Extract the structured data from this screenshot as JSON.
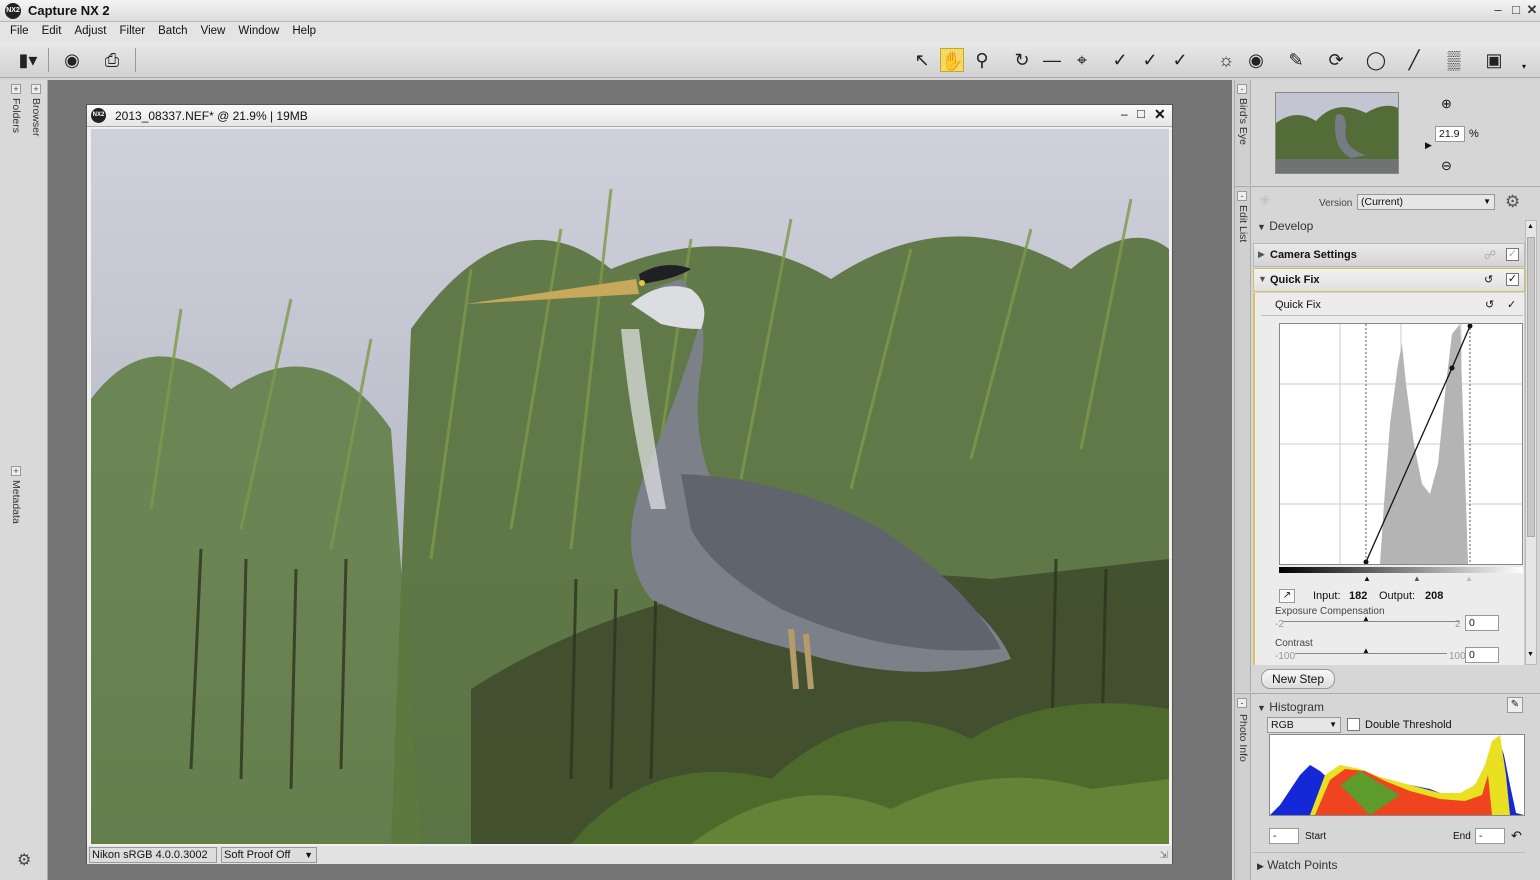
{
  "app": {
    "title": "Capture NX 2",
    "logo_text": "NX2"
  },
  "menu": [
    "File",
    "Edit",
    "Adjust",
    "Filter",
    "Batch",
    "View",
    "Window",
    "Help"
  ],
  "left_panels": {
    "folders": "Folders",
    "browser": "Browser",
    "metadata": "Metadata"
  },
  "image_window": {
    "title": "2013_08337.NEF* @ 21.9% | 19MB",
    "profile": "Nikon sRGB 4.0.0.3002",
    "soft_proof": "Soft Proof Off"
  },
  "birds_eye": {
    "label": "Bird's Eye",
    "zoom": "21.9",
    "unit": "%"
  },
  "edit_list": {
    "label": "Edit List",
    "version_label": "Version",
    "version_value": "(Current)",
    "develop": "Develop",
    "camera_settings": "Camera Settings",
    "quick_fix_header": "Quick Fix",
    "quick_fix_step": "Quick Fix",
    "input_label": "Input:",
    "input_value": "182",
    "output_label": "Output:",
    "output_value": "208",
    "exposure_label": "Exposure Compensation",
    "exposure_min": "-2",
    "exposure_max": "2",
    "exposure_value": "0",
    "contrast_label": "Contrast",
    "contrast_min": "-100",
    "contrast_max": "100",
    "contrast_value": "0",
    "new_step": "New Step"
  },
  "photo_info": {
    "label": "Photo Info",
    "histogram": "Histogram",
    "channel": "RGB",
    "double_threshold": "Double Threshold",
    "start_label": "Start",
    "start_value": "-",
    "end_label": "End",
    "end_value": "-",
    "watch_points": "Watch Points"
  },
  "colors": {
    "accent": "#f3d86a",
    "canvas": "#757575",
    "panel": "#d6d6d6"
  }
}
